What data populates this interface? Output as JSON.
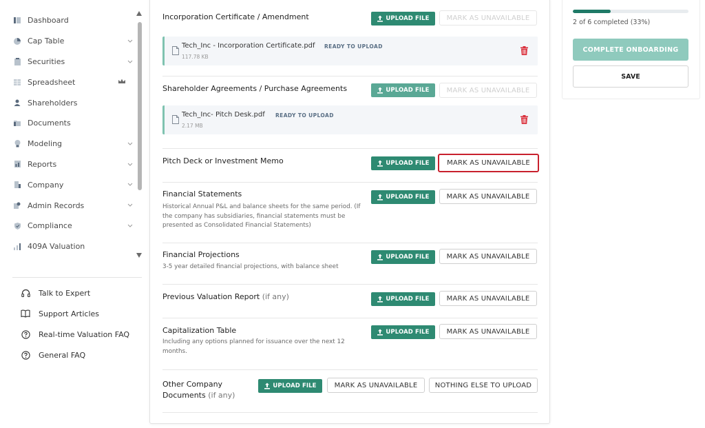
{
  "sidebar": {
    "nav_items": [
      {
        "label": "Dashboard",
        "icon": "dashboard-icon"
      },
      {
        "label": "Cap Table",
        "icon": "pie-chart-icon"
      },
      {
        "label": "Securities",
        "icon": "clipboard-icon"
      },
      {
        "label": "Spreadsheet",
        "icon": "spreadsheet-icon"
      },
      {
        "label": "Shareholders",
        "icon": "person-icon"
      },
      {
        "label": "Documents",
        "icon": "folder-icon"
      },
      {
        "label": "Modeling",
        "icon": "lightbulb-icon"
      },
      {
        "label": "Reports",
        "icon": "report-icon"
      },
      {
        "label": "Company",
        "icon": "building-icon"
      },
      {
        "label": "Admin Records",
        "icon": "admin-records-icon"
      },
      {
        "label": "Compliance",
        "icon": "shield-icon"
      },
      {
        "label": "409A Valuation",
        "icon": "valuation-icon"
      }
    ],
    "help_items": [
      {
        "label": "Talk to Expert",
        "icon": "headset-icon"
      },
      {
        "label": "Support Articles",
        "icon": "book-icon"
      },
      {
        "label": "Real-time Valuation FAQ",
        "icon": "question-circle-icon"
      },
      {
        "label": "General FAQ",
        "icon": "question-circle-icon"
      }
    ]
  },
  "main": {
    "upload_label": "UPLOAD FILE",
    "unavailable_label": "MARK AS UNAVAILABLE",
    "nothing_else_label": "NOTHING ELSE TO UPLOAD",
    "sections": {
      "incorporation": {
        "title": "Incorporation Certificate / Amendment",
        "file": {
          "name": "Tech_Inc - Incorporation Certificate.pdf",
          "status": "READY TO UPLOAD",
          "size": "117.78 KB"
        }
      },
      "shareholder": {
        "title": "Shareholder Agreements / Purchase Agreements",
        "file": {
          "name": "Tech_Inc- Pitch Desk.pdf",
          "status": "READY TO UPLOAD",
          "size": "2.17 MB"
        }
      },
      "pitch": {
        "title": "Pitch Deck or Investment Memo"
      },
      "financial_statements": {
        "title": "Financial Statements",
        "desc": "Historical Annual P&L and balance sheets for the same period. (If the company has subsidiaries, financial statements must be presented as Consolidated Financial Statements)"
      },
      "financial_projections": {
        "title": "Financial Projections",
        "desc": "3-5 year detailed financial projections, with balance sheet"
      },
      "previous_valuation": {
        "title": "Previous Valuation Report",
        "suffix": "(if any)"
      },
      "cap_table": {
        "title": "Capitalization Table",
        "desc": "Including any options planned for issuance over the next 12 months."
      },
      "other": {
        "title_line1": "Other Company",
        "title_line2": "Documents",
        "suffix": "(if any)"
      }
    }
  },
  "progress": {
    "fraction": 0.33,
    "text": "2 of 6 completed (33%)",
    "complete_label": "COMPLETE ONBOARDING",
    "save_label": "SAVE"
  },
  "colors": {
    "primary": "#2e8a72",
    "primary_light": "#5aa895",
    "complete_button": "#8fcabd",
    "highlight_border": "#c8202d",
    "trash": "#d9303c"
  }
}
